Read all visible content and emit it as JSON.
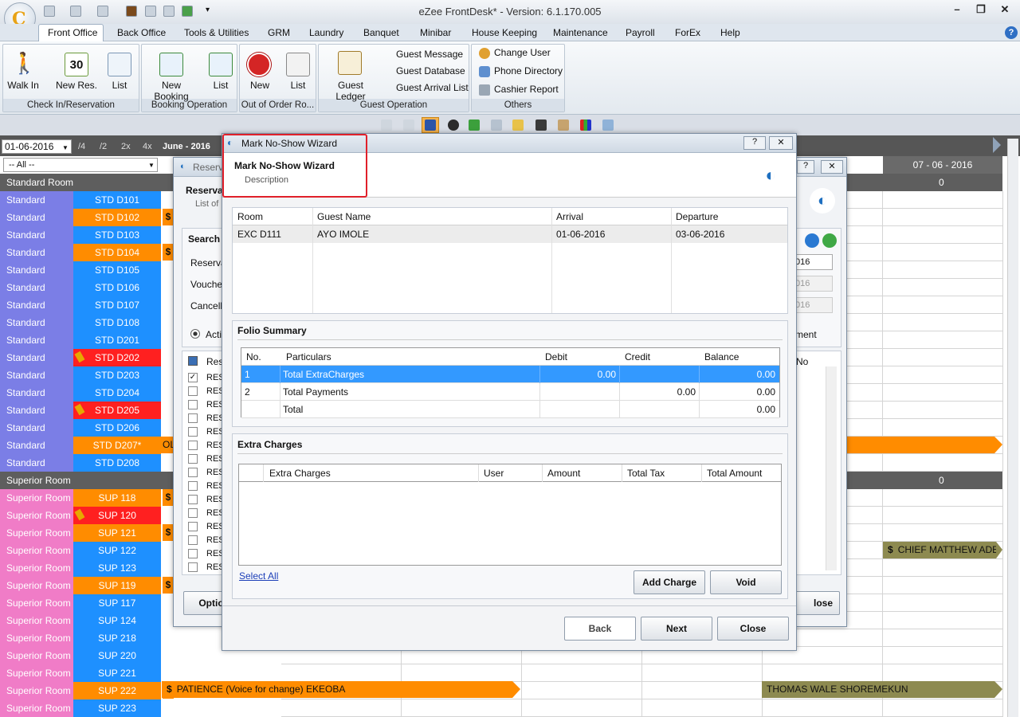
{
  "app": {
    "title": "eZee FrontDesk* - Version: 6.1.170.005"
  },
  "menu": [
    "Front Office",
    "Back Office",
    "Tools & Utilities",
    "GRM",
    "Laundry",
    "Banquet",
    "Minibar",
    "House Keeping",
    "Maintenance",
    "Payroll",
    "ForEx",
    "Help"
  ],
  "ribbon": {
    "checkin": {
      "walkin": "Walk In",
      "newres": "New Res.",
      "list": "List",
      "group": "Check In/Reservation",
      "cal_day": "30"
    },
    "booking": {
      "newbooking": "New Booking",
      "list": "List",
      "group": "Booking Operation"
    },
    "outoforder": {
      "new": "New",
      "list": "List",
      "group": "Out of Order Ro..."
    },
    "guestop": {
      "ledger": "Guest Ledger",
      "message": "Guest Message",
      "database": "Guest Database",
      "arrival": "Guest Arrival List",
      "group": "Guest Operation"
    },
    "others": {
      "changeuser": "Change User",
      "phone": "Phone Directory",
      "cashier": "Cashier Report",
      "group": "Others"
    }
  },
  "grid": {
    "date": "01-06-2016",
    "filter": "-- All --",
    "zoom": [
      "/4",
      "/2",
      "2x",
      "4x"
    ],
    "month": "June - 2016",
    "col_header": "07 - 06 - 2016",
    "std_header": "Standard Room",
    "std_count": "0",
    "sup_header": "Superior Room",
    "sup_count": "0",
    "rooms": [
      {
        "type": "Standard Room",
        "num": "STD D101",
        "st": "b"
      },
      {
        "type": "Standard Room",
        "num": "STD D102",
        "st": "o"
      },
      {
        "type": "Standard Room",
        "num": "STD D103",
        "st": "b"
      },
      {
        "type": "Standard Room",
        "num": "STD D104",
        "st": "o"
      },
      {
        "type": "Standard Room",
        "num": "STD D105",
        "st": "b"
      },
      {
        "type": "Standard Room",
        "num": "STD D106",
        "st": "b"
      },
      {
        "type": "Standard Room",
        "num": "STD D107",
        "st": "b"
      },
      {
        "type": "Standard Room",
        "num": "STD D108",
        "st": "b"
      },
      {
        "type": "Standard Room",
        "num": "STD D201",
        "st": "b"
      },
      {
        "type": "Standard Room",
        "num": "STD D202",
        "st": "r"
      },
      {
        "type": "Standard Room",
        "num": "STD D203",
        "st": "b"
      },
      {
        "type": "Standard Room",
        "num": "STD D204",
        "st": "b"
      },
      {
        "type": "Standard Room",
        "num": "STD D205",
        "st": "r"
      },
      {
        "type": "Standard Room",
        "num": "STD D206",
        "st": "b"
      },
      {
        "type": "Standard Room",
        "num": "STD D207*",
        "st": "o"
      },
      {
        "type": "Standard Room",
        "num": "STD D208",
        "st": "b"
      }
    ],
    "suprooms": [
      {
        "type": "Superior Room",
        "num": "SUP 118",
        "st": "o"
      },
      {
        "type": "Superior Room",
        "num": "SUP 120",
        "st": "r"
      },
      {
        "type": "Superior Room",
        "num": "SUP 121",
        "st": "o"
      },
      {
        "type": "Superior Room",
        "num": "SUP 122",
        "st": "b"
      },
      {
        "type": "Superior Room",
        "num": "SUP 123",
        "st": "b"
      },
      {
        "type": "Superior Room",
        "num": "SUP 119",
        "st": "o"
      },
      {
        "type": "Superior Room",
        "num": "SUP 117",
        "st": "b"
      },
      {
        "type": "Superior Room",
        "num": "SUP 124",
        "st": "b"
      },
      {
        "type": "Superior Room",
        "num": "SUP 218",
        "st": "b"
      },
      {
        "type": "Superior Room",
        "num": "SUP 220",
        "st": "b"
      },
      {
        "type": "Superior Room",
        "num": "SUP 221",
        "st": "b"
      },
      {
        "type": "Superior Room",
        "num": "SUP 222",
        "st": "o"
      },
      {
        "type": "Superior Room",
        "num": "SUP 223",
        "st": "b"
      }
    ],
    "bar1": "PATIENCE (Voice for change) EKEOBA",
    "bar2": "THOMAS WALE SHOREMEKUN",
    "bar3": "CHIEF MATTHEW ADERI",
    "bar_std207": "OL",
    "colors": {
      "std_type": "#7b7ee6",
      "sup_type": "#f07cc7",
      "blue": "#1e90ff",
      "orange": "#ff8c00",
      "red": "#ff2020",
      "olive": "#8d8a50"
    }
  },
  "back_dialog": {
    "title": "Reserva",
    "heading": "Reserva",
    "sub": "List of r",
    "search": "Search",
    "reserv": "Reserva",
    "voucher": "Voucher",
    "cancel": "Cancella",
    "active": "Activ",
    "res_hdr": "Res",
    "res_rows": [
      "RES",
      "RES",
      "RES",
      "RES",
      "RES",
      "RES",
      "RES",
      "RES",
      "RES",
      "RES",
      "RES",
      "RES",
      "RES",
      "RES",
      "RES"
    ],
    "date1": "016",
    "date2": "016",
    "date3": "016",
    "payment": "ment",
    "no": "No",
    "option": "Optio",
    "close": "lose"
  },
  "wizard": {
    "title": "Mark No-Show Wizard",
    "heading": "Mark No-Show Wizard",
    "desc": "Description",
    "room_cols": [
      "Room",
      "Guest Name",
      "Arrival",
      "Departure"
    ],
    "room_rows": [
      [
        "EXC D111",
        "AYO IMOLE",
        "01-06-2016",
        "03-06-2016"
      ]
    ],
    "folio_title": "Folio Summary",
    "folio_cols": [
      "No.",
      "Particulars",
      "Debit",
      "Credit",
      "Balance"
    ],
    "folio_rows": [
      [
        "1",
        "Total ExtraCharges",
        "0.00",
        "",
        "0.00"
      ],
      [
        "2",
        "Total Payments",
        "",
        "0.00",
        "0.00"
      ],
      [
        "",
        "Total",
        "",
        "",
        "0.00"
      ]
    ],
    "extra_title": "Extra Charges",
    "extra_cols": [
      "Extra Charges",
      "User",
      "Amount",
      "Total Tax",
      "Total Amount"
    ],
    "select_all": "Select All",
    "add_charge": "Add Charge",
    "void": "Void",
    "back": "Back",
    "next": "Next",
    "close": "Close"
  }
}
